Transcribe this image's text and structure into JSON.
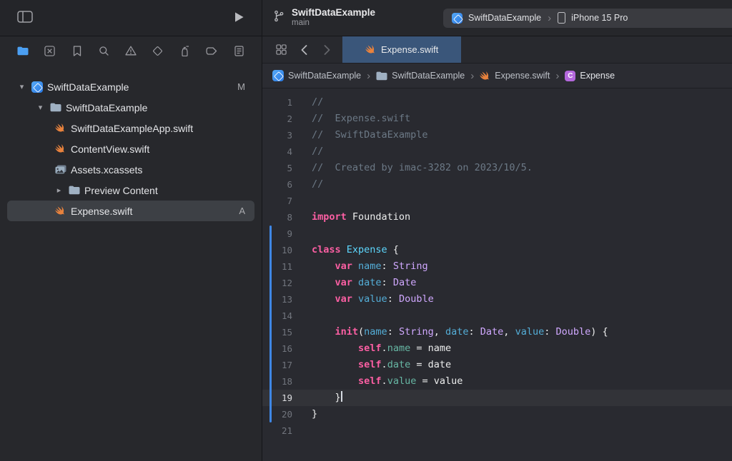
{
  "toolbar": {
    "project_title": "SwiftDataExample",
    "branch": "main",
    "scheme_target": "SwiftDataExample",
    "scheme_device": "iPhone 15 Pro"
  },
  "sidebar": {
    "navigators": [
      {
        "name": "project-navigator",
        "icon": "folder-active",
        "active": true
      },
      {
        "name": "source-control-navigator",
        "icon": "xsquare",
        "active": false
      },
      {
        "name": "bookmark-navigator",
        "icon": "bookmark",
        "active": false
      },
      {
        "name": "find-navigator",
        "icon": "search",
        "active": false
      },
      {
        "name": "issue-navigator",
        "icon": "warning",
        "active": false
      },
      {
        "name": "test-navigator",
        "icon": "diamond",
        "active": false
      },
      {
        "name": "debug-navigator",
        "icon": "spray",
        "active": false
      },
      {
        "name": "breakpoint-navigator",
        "icon": "capsule",
        "active": false
      },
      {
        "name": "report-navigator",
        "icon": "report",
        "active": false
      }
    ],
    "items": [
      {
        "label": "SwiftDataExample",
        "icon": "project",
        "depth": 0,
        "disclosure": "open",
        "badge": "M",
        "selected": false
      },
      {
        "label": "SwiftDataExample",
        "icon": "folder",
        "depth": 1,
        "disclosure": "open",
        "badge": "",
        "selected": false
      },
      {
        "label": "SwiftDataExampleApp.swift",
        "icon": "swift",
        "depth": 2,
        "disclosure": "",
        "badge": "",
        "selected": false
      },
      {
        "label": "ContentView.swift",
        "icon": "swift",
        "depth": 2,
        "disclosure": "",
        "badge": "",
        "selected": false
      },
      {
        "label": "Assets.xcassets",
        "icon": "assets",
        "depth": 2,
        "disclosure": "",
        "badge": "",
        "selected": false
      },
      {
        "label": "Preview Content",
        "icon": "folder",
        "depth": 2,
        "disclosure": "closed",
        "badge": "",
        "selected": false
      },
      {
        "label": "Expense.swift",
        "icon": "swift",
        "depth": 2,
        "disclosure": "",
        "badge": "A",
        "selected": true
      }
    ]
  },
  "tabbar": {
    "active_tab": "Expense.swift"
  },
  "breadcrumb": {
    "items": [
      {
        "icon": "project",
        "label": "SwiftDataExample"
      },
      {
        "icon": "folder",
        "label": "SwiftDataExample"
      },
      {
        "icon": "swift",
        "label": "Expense.swift"
      },
      {
        "icon": "class",
        "label": "Expense"
      }
    ]
  },
  "editor": {
    "current_line": 19,
    "lines": [
      {
        "n": 1,
        "tokens": [
          {
            "c": "cm",
            "t": "//"
          }
        ]
      },
      {
        "n": 2,
        "tokens": [
          {
            "c": "cm",
            "t": "//  Expense.swift"
          }
        ]
      },
      {
        "n": 3,
        "tokens": [
          {
            "c": "cm",
            "t": "//  SwiftDataExample"
          }
        ]
      },
      {
        "n": 4,
        "tokens": [
          {
            "c": "cm",
            "t": "//"
          }
        ]
      },
      {
        "n": 5,
        "tokens": [
          {
            "c": "cm",
            "t": "//  Created by imac-3282 on 2023/10/5."
          }
        ]
      },
      {
        "n": 6,
        "tokens": [
          {
            "c": "cm",
            "t": "//"
          }
        ]
      },
      {
        "n": 7,
        "tokens": []
      },
      {
        "n": 8,
        "tokens": [
          {
            "c": "kw",
            "t": "import"
          },
          {
            "c": "pl",
            "t": " Foundation"
          }
        ]
      },
      {
        "n": 9,
        "tokens": []
      },
      {
        "n": 10,
        "tokens": [
          {
            "c": "kw",
            "t": "class"
          },
          {
            "c": "decl",
            "t": " Expense"
          },
          {
            "c": "pl",
            "t": " {"
          }
        ]
      },
      {
        "n": 11,
        "tokens": [
          {
            "c": "pl",
            "t": "    "
          },
          {
            "c": "kw",
            "t": "var"
          },
          {
            "c": "prop",
            "t": " name"
          },
          {
            "c": "pl",
            "t": ": "
          },
          {
            "c": "ty",
            "t": "String"
          }
        ]
      },
      {
        "n": 12,
        "tokens": [
          {
            "c": "pl",
            "t": "    "
          },
          {
            "c": "kw",
            "t": "var"
          },
          {
            "c": "prop",
            "t": " date"
          },
          {
            "c": "pl",
            "t": ": "
          },
          {
            "c": "ty",
            "t": "Date"
          }
        ]
      },
      {
        "n": 13,
        "tokens": [
          {
            "c": "pl",
            "t": "    "
          },
          {
            "c": "kw",
            "t": "var"
          },
          {
            "c": "prop",
            "t": " value"
          },
          {
            "c": "pl",
            "t": ": "
          },
          {
            "c": "ty",
            "t": "Double"
          }
        ]
      },
      {
        "n": 14,
        "tokens": []
      },
      {
        "n": 15,
        "tokens": [
          {
            "c": "pl",
            "t": "    "
          },
          {
            "c": "kw",
            "t": "init"
          },
          {
            "c": "pl",
            "t": "("
          },
          {
            "c": "prop",
            "t": "name"
          },
          {
            "c": "pl",
            "t": ": "
          },
          {
            "c": "ty",
            "t": "String"
          },
          {
            "c": "pl",
            "t": ", "
          },
          {
            "c": "prop",
            "t": "date"
          },
          {
            "c": "pl",
            "t": ": "
          },
          {
            "c": "ty",
            "t": "Date"
          },
          {
            "c": "pl",
            "t": ", "
          },
          {
            "c": "prop",
            "t": "value"
          },
          {
            "c": "pl",
            "t": ": "
          },
          {
            "c": "ty",
            "t": "Double"
          },
          {
            "c": "pl",
            "t": ") {"
          }
        ]
      },
      {
        "n": 16,
        "tokens": [
          {
            "c": "pl",
            "t": "        "
          },
          {
            "c": "kw",
            "t": "self"
          },
          {
            "c": "pl",
            "t": "."
          },
          {
            "c": "mb",
            "t": "name"
          },
          {
            "c": "pl",
            "t": " = name"
          }
        ]
      },
      {
        "n": 17,
        "tokens": [
          {
            "c": "pl",
            "t": "        "
          },
          {
            "c": "kw",
            "t": "self"
          },
          {
            "c": "pl",
            "t": "."
          },
          {
            "c": "mb",
            "t": "date"
          },
          {
            "c": "pl",
            "t": " = date"
          }
        ]
      },
      {
        "n": 18,
        "tokens": [
          {
            "c": "pl",
            "t": "        "
          },
          {
            "c": "kw",
            "t": "self"
          },
          {
            "c": "pl",
            "t": "."
          },
          {
            "c": "mb",
            "t": "value"
          },
          {
            "c": "pl",
            "t": " = value"
          }
        ]
      },
      {
        "n": 19,
        "tokens": [
          {
            "c": "pl",
            "t": "    }"
          }
        ],
        "cursor": true
      },
      {
        "n": 20,
        "tokens": [
          {
            "c": "pl",
            "t": "}"
          }
        ]
      },
      {
        "n": 21,
        "tokens": []
      }
    ]
  },
  "chars": {
    "sep": "›",
    "disc_open": "▾",
    "disc_closed": "▸",
    "class_symbol": "C"
  },
  "colors": {
    "accent_blue": "#3f87e5",
    "selected_tab": "#3a567a",
    "swift_orange": "#e8823d",
    "syntax_comment": "#6c7986",
    "syntax_keyword": "#fc5fa3",
    "syntax_type": "#d0a8ff",
    "syntax_declaration": "#5dd8ff",
    "syntax_property": "#54aed8",
    "syntax_member": "#67b7a4"
  }
}
